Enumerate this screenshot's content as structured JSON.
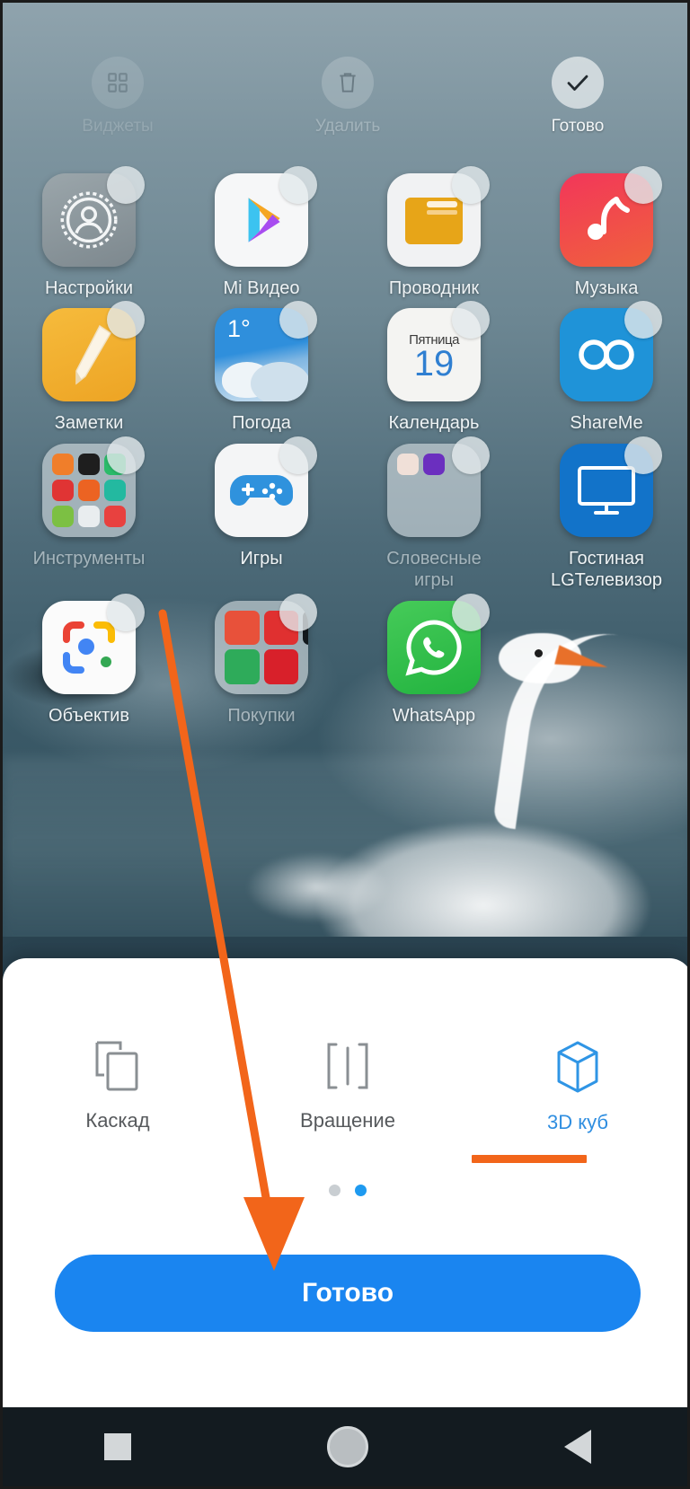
{
  "topbar": {
    "actions": [
      {
        "label": "Виджеты",
        "icon": "widgets-icon",
        "state": "faded"
      },
      {
        "label": "Удалить",
        "icon": "trash-icon",
        "state": "faded"
      },
      {
        "label": "Готово",
        "icon": "check-icon",
        "state": "active"
      }
    ]
  },
  "homescreen": {
    "rows": [
      [
        {
          "label": "Настройки",
          "icon": "settings-gear-icon",
          "kind": "app"
        },
        {
          "label": "Mi Видео",
          "icon": "mi-video-play-icon",
          "kind": "app"
        },
        {
          "label": "Проводник",
          "icon": "file-manager-folder-icon",
          "kind": "app"
        },
        {
          "label": "Музыка",
          "icon": "music-note-icon",
          "kind": "app"
        }
      ],
      [
        {
          "label": "Заметки",
          "icon": "notes-pencil-icon",
          "kind": "app"
        },
        {
          "label": "Погода",
          "icon": "weather-cloud-icon",
          "kind": "app",
          "temp": "1°"
        },
        {
          "label": "Календарь",
          "icon": "calendar-icon",
          "kind": "app",
          "weekday": "Пятница",
          "day": "19"
        },
        {
          "label": "ShareMe",
          "icon": "shareme-infinity-icon",
          "kind": "app"
        }
      ],
      [
        {
          "label": "Инструменты",
          "icon": "tools-folder-icon",
          "kind": "folder"
        },
        {
          "label": "Игры",
          "icon": "games-gamepad-icon",
          "kind": "app"
        },
        {
          "label": "Словесные игры",
          "icon": "word-games-folder-icon",
          "kind": "folder"
        },
        {
          "label": "Гостиная LGТелевизор",
          "icon": "lg-tv-monitor-icon",
          "kind": "app"
        }
      ],
      [
        {
          "label": "Объектив",
          "icon": "google-lens-icon",
          "kind": "app"
        },
        {
          "label": "Покупки",
          "icon": "shopping-folder-icon",
          "kind": "folder"
        },
        {
          "label": "WhatsApp",
          "icon": "whatsapp-icon",
          "kind": "app"
        },
        {
          "label": "",
          "icon": "",
          "kind": "empty"
        }
      ]
    ]
  },
  "sheet": {
    "effects": [
      {
        "label": "Каскад",
        "icon": "cascade-icon",
        "selected": false
      },
      {
        "label": "Вращение",
        "icon": "rotation-icon",
        "selected": false
      },
      {
        "label": "3D куб",
        "icon": "cube-3d-icon",
        "selected": true
      }
    ],
    "pager": {
      "pages": 2,
      "current": 2
    },
    "done_label": "Готово"
  },
  "navbar": {
    "buttons": [
      {
        "label": "Недавние",
        "icon": "recents-square-icon"
      },
      {
        "label": "Домой",
        "icon": "home-circle-icon"
      },
      {
        "label": "Назад",
        "icon": "back-triangle-icon"
      }
    ]
  },
  "colors": {
    "accent_blue": "#1a85f0",
    "selected_blue": "#2f8ee0",
    "annotation_orange": "#f2651a",
    "sheet_bg": "#ffffff",
    "navbar_bg": "#131b20"
  }
}
